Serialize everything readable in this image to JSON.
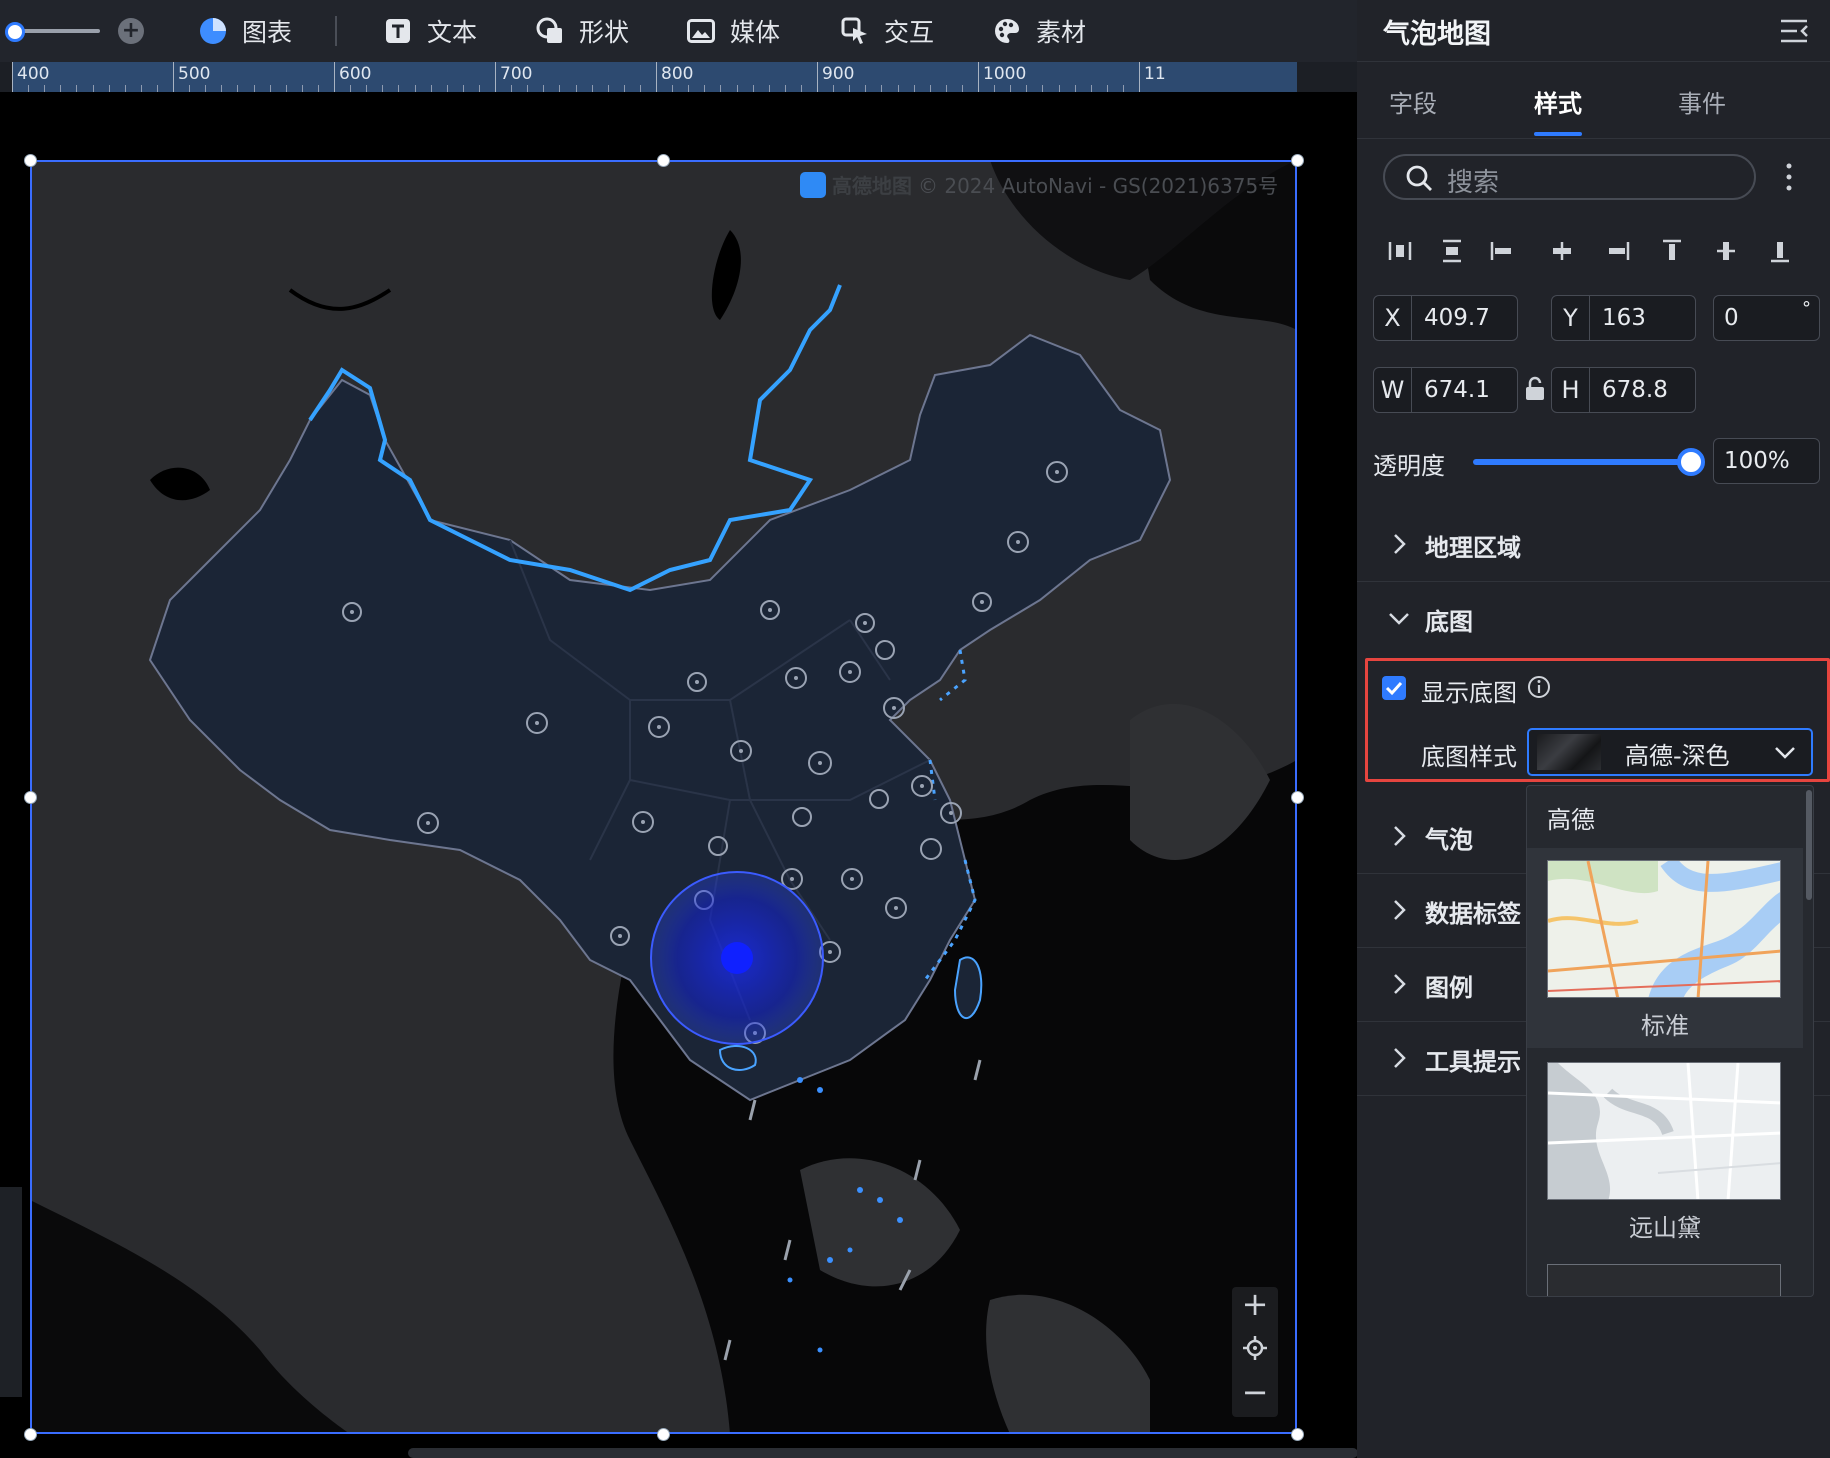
{
  "toolbar": {
    "items": [
      {
        "label": "图表",
        "icon": "pie-chart-icon"
      },
      {
        "label": "文本",
        "icon": "text-icon"
      },
      {
        "label": "形状",
        "icon": "shape-icon"
      },
      {
        "label": "媒体",
        "icon": "image-icon"
      },
      {
        "label": "交互",
        "icon": "pointer-icon"
      },
      {
        "label": "素材",
        "icon": "palette-icon"
      }
    ]
  },
  "ruler": {
    "labels": [
      "400",
      "500",
      "600",
      "700",
      "800",
      "900",
      "1000",
      "11"
    ]
  },
  "map": {
    "attribution_brand": "高德地图",
    "attribution_text": "© 2024 AutoNavi - GS(2021)6375号"
  },
  "panel": {
    "title": "气泡地图",
    "tabs": [
      "字段",
      "样式",
      "事件"
    ],
    "active_tab": "样式",
    "search_placeholder": "搜索",
    "x": {
      "label": "X",
      "value": "409.7"
    },
    "y": {
      "label": "Y",
      "value": "163"
    },
    "rotation": {
      "value": "0",
      "unit": "°"
    },
    "w": {
      "label": "W",
      "value": "674.1"
    },
    "h": {
      "label": "H",
      "value": "678.8"
    },
    "opacity": {
      "label": "透明度",
      "value": "100%",
      "level": 1.0
    },
    "sections": [
      "地理区域",
      "底图",
      "气泡",
      "数据标签",
      "图例",
      "工具提示"
    ],
    "basemap": {
      "show_label": "显示底图",
      "show_checked": true,
      "style_label": "底图样式",
      "style_value": "高德-深色"
    },
    "dropdown": {
      "group": "高德",
      "options": [
        "标准",
        "远山黛"
      ]
    }
  },
  "colors": {
    "accent": "#2f7bff",
    "highlight": "#e6453f",
    "panel_bg": "#212329",
    "map_china": "#1b2536",
    "border_blue": "#35a2ff"
  }
}
